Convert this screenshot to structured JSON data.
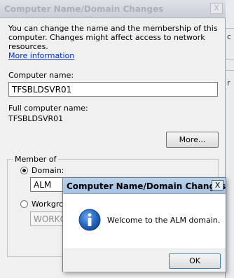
{
  "main_dialog": {
    "title": "Computer Name/Domain Changes",
    "close_glyph": "X",
    "intro_text": "You can change the name and the membership of this computer. Changes might affect access to network resources.",
    "more_info_link": "More information",
    "computer_name_label": "Computer name:",
    "computer_name_value": "TFSBLDSVR01",
    "full_name_label": "Full computer name:",
    "full_name_value": "TFSBLDSVR01",
    "more_button": "More...",
    "member_of_label": "Member of",
    "domain_label": "Domain:",
    "domain_value": "ALM",
    "workgroup_label": "Workgrou",
    "workgroup_value": "WORKG"
  },
  "popup": {
    "title": "Computer Name/Domain Changes",
    "close_glyph": "X",
    "icon": "info-icon",
    "message": "Welcome to the ALM domain.",
    "ok_button": "OK"
  },
  "background_window": {
    "char_1": "c",
    "char_2": "r"
  },
  "colors": {
    "popup_titlebar": "#a6c3e2",
    "link": "#0033cc",
    "info_icon": "#1e5fb8"
  }
}
